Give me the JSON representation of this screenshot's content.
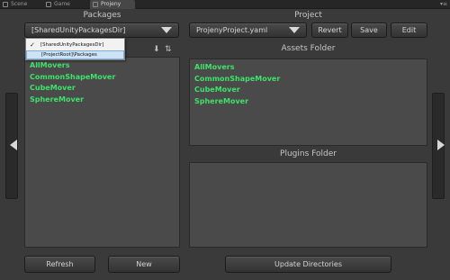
{
  "tabs": [
    {
      "label": "Scene"
    },
    {
      "label": "Game"
    },
    {
      "label": "Projeny"
    }
  ],
  "left_panel": {
    "title": "Packages",
    "dropdown_value": "[SharedUnityPackagesDir]",
    "popup_options": [
      "[SharedUnityPackagesDir]",
      "[ProjectRoot]\\Packages"
    ],
    "items": [
      "AllMovers",
      "CommonShapeMover",
      "CubeMover",
      "SphereMover"
    ],
    "refresh_label": "Refresh",
    "new_label": "New"
  },
  "right_panel": {
    "title": "Project",
    "project_dropdown": "ProjenyProject.yaml",
    "revert_label": "Revert",
    "save_label": "Save",
    "edit_label": "Edit",
    "assets_title": "Assets Folder",
    "assets_items": [
      "AllMovers",
      "CommonShapeMover",
      "CubeMover",
      "SphereMover"
    ],
    "plugins_title": "Plugins Folder",
    "update_label": "Update Directories"
  },
  "colors": {
    "background": "#3a3a3a",
    "list_background": "#4a4a4a",
    "item_text": "#3ee26a"
  }
}
